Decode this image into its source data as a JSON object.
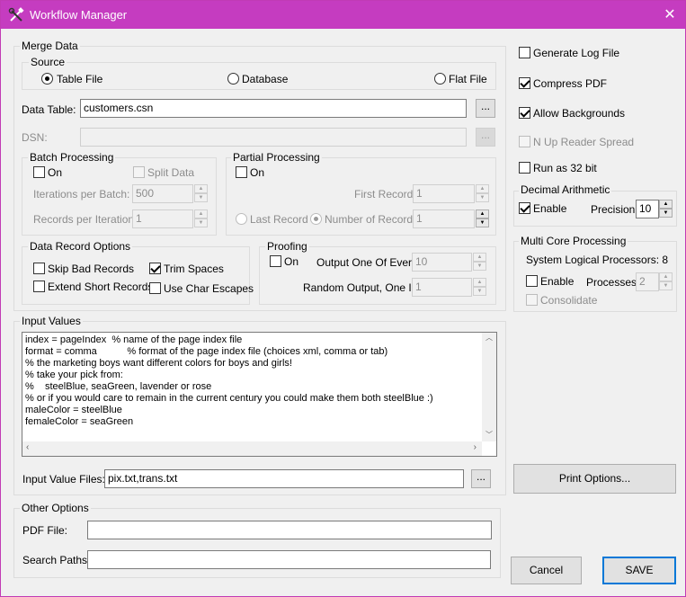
{
  "window": {
    "title": "Workflow Manager",
    "close_glyph": "✕",
    "accent": "#c53cc0"
  },
  "merge_data": {
    "label": "Merge Data",
    "source": {
      "label": "Source",
      "table_file": "Table File",
      "database": "Database",
      "flat_file": "Flat File",
      "selected": "Table File"
    },
    "data_table_label": "Data Table:",
    "data_table_value": "customers.csn",
    "dsn_label": "DSN:",
    "dsn_value": "",
    "browse_label": "...",
    "batch": {
      "label": "Batch Processing",
      "on_label": "On",
      "on_checked": false,
      "split_label": "Split Data",
      "iter_label": "Iterations per Batch:",
      "iter_value": "500",
      "records_label": "Records per Iteration:",
      "records_value": "1"
    },
    "partial": {
      "label": "Partial Processing",
      "on_label": "On",
      "first_record_label": "First Record:",
      "first_record_value": "1",
      "last_record_label": "Last Record",
      "number_label": "Number of Records",
      "number_value": "1"
    },
    "record_options": {
      "label": "Data Record Options",
      "skip_bad": "Skip Bad Records",
      "trim_spaces": "Trim Spaces",
      "extend_short": "Extend Short Records",
      "char_escapes": "Use Char Escapes"
    },
    "proofing": {
      "label": "Proofing",
      "on_label": "On",
      "output_label": "Output One Of Every:",
      "output_value": "10",
      "random_label": "Random Output, One In:",
      "random_value": "1"
    }
  },
  "options": {
    "generate_log": "Generate Log File",
    "compress_pdf": "Compress PDF",
    "allow_backgrounds": "Allow Backgrounds",
    "n_up": "N Up Reader Spread",
    "run_32": "Run as 32 bit"
  },
  "decimal": {
    "label": "Decimal Arithmetic",
    "enable_label": "Enable",
    "precision_label": "Precision:",
    "precision_value": "10"
  },
  "multicore": {
    "label": "Multi Core Processing",
    "system_label": "System Logical Processors: 8",
    "enable_label": "Enable",
    "processes_label": "Processes:",
    "processes_value": "2",
    "consolidate_label": "Consolidate"
  },
  "input_values": {
    "label": "Input Values",
    "text": "index = pageIndex  % name of the page index file\nformat = comma           % format of the page index file (choices xml, comma or tab)\n% the marketing boys want different colors for boys and girls!\n% take your pick from:\n%    steelBlue, seaGreen, lavender or rose\n% or if you would care to remain in the current century you could make them both steelBlue :)\nmaleColor = steelBlue\nfemaleColor = seaGreen",
    "files_label": "Input Value Files:",
    "files_value": "pix.txt,trans.txt"
  },
  "other": {
    "label": "Other Options",
    "pdf_label": "PDF File:",
    "pdf_value": "",
    "search_label": "Search Paths:",
    "search_value": ""
  },
  "buttons": {
    "print_options": "Print Options...",
    "cancel": "Cancel",
    "save": "SAVE"
  }
}
